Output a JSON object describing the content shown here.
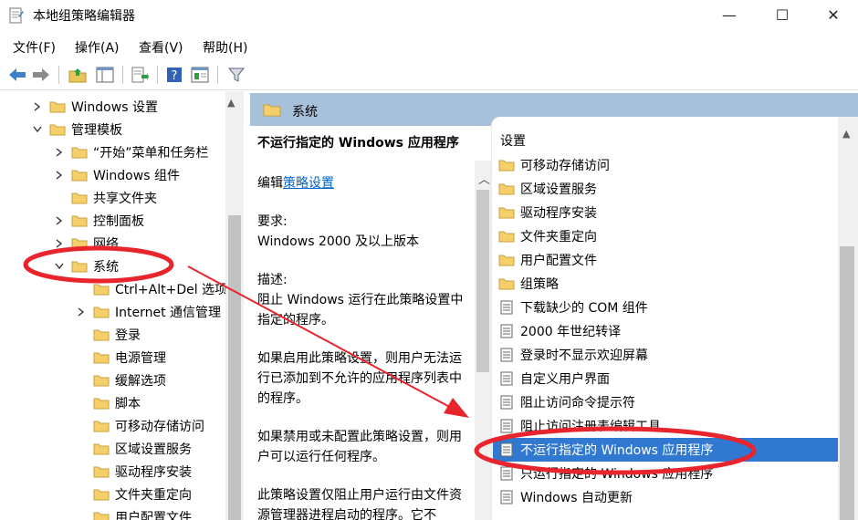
{
  "window": {
    "title": "本地组策略编辑器",
    "controls": {
      "minimize": "—",
      "maximize": "☐",
      "close": "✕"
    }
  },
  "menubar": {
    "items": [
      "文件(F)",
      "操作(A)",
      "查看(V)",
      "帮助(H)"
    ]
  },
  "toolbar": {
    "icons": [
      "back-arrow-icon",
      "forward-arrow-icon",
      "up-folder-icon",
      "show-hide-tree-icon",
      "export-list-icon",
      "help-icon",
      "properties-icon",
      "filter-icon"
    ]
  },
  "tree": {
    "items": [
      {
        "label": "Windows 设置",
        "chevron": "right",
        "level": 1
      },
      {
        "label": "管理模板",
        "chevron": "down",
        "level": 1
      },
      {
        "label": "“开始”菜单和任务栏",
        "chevron": "right",
        "level": 2
      },
      {
        "label": "Windows 组件",
        "chevron": "right",
        "level": 2
      },
      {
        "label": "共享文件夹",
        "chevron": "",
        "level": 2
      },
      {
        "label": "控制面板",
        "chevron": "right",
        "level": 2
      },
      {
        "label": "网络",
        "chevron": "right",
        "level": 2
      },
      {
        "label": "系统",
        "chevron": "down",
        "level": 2
      },
      {
        "label": "Ctrl+Alt+Del 选项",
        "chevron": "",
        "level": 3
      },
      {
        "label": "Internet 通信管理",
        "chevron": "right",
        "level": 3
      },
      {
        "label": "登录",
        "chevron": "",
        "level": 3
      },
      {
        "label": "电源管理",
        "chevron": "",
        "level": 3
      },
      {
        "label": "缓解选项",
        "chevron": "",
        "level": 3
      },
      {
        "label": "脚本",
        "chevron": "",
        "level": 3
      },
      {
        "label": "可移动存储访问",
        "chevron": "",
        "level": 3
      },
      {
        "label": "区域设置服务",
        "chevron": "",
        "level": 3
      },
      {
        "label": "驱动程序安装",
        "chevron": "",
        "level": 3
      },
      {
        "label": "文件夹重定向",
        "chevron": "",
        "level": 3
      },
      {
        "label": "用户配置文件",
        "chevron": "",
        "level": 3
      }
    ]
  },
  "right_header": {
    "title": "系统"
  },
  "description": {
    "policy_title": "不运行指定的 Windows 应用程序",
    "edit_prefix": "编辑",
    "edit_link": "策略设置",
    "requirements_label": "要求:",
    "requirements_value": "Windows 2000 及以上版本",
    "description_label": "描述:",
    "description_text": "阻止 Windows 运行在此策略设置中指定的程序。",
    "enabled_text": "如果启用此策略设置，则用户无法运行已添加到不允许的应用程序列表中的程序。",
    "disabled_text": "如果禁用或未配置此策略设置，则用户可以运行任何程序。",
    "note_text": "此策略设置仅阻止用户运行由文件资源管理器进程启动的程序。它不"
  },
  "settings_list": {
    "header": "设置",
    "items": [
      {
        "label": "可移动存储访问",
        "icon": "folder-icon"
      },
      {
        "label": "区域设置服务",
        "icon": "folder-icon"
      },
      {
        "label": "驱动程序安装",
        "icon": "folder-icon"
      },
      {
        "label": "文件夹重定向",
        "icon": "folder-icon"
      },
      {
        "label": "用户配置文件",
        "icon": "folder-icon"
      },
      {
        "label": "组策略",
        "icon": "folder-icon"
      },
      {
        "label": "下载缺少的 COM 组件",
        "icon": "policy-setting-icon"
      },
      {
        "label": "2000 年世纪转译",
        "icon": "policy-setting-icon"
      },
      {
        "label": "登录时不显示欢迎屏幕",
        "icon": "policy-setting-icon"
      },
      {
        "label": "自定义用户界面",
        "icon": "policy-setting-icon"
      },
      {
        "label": "阻止访问命令提示符",
        "icon": "policy-setting-icon"
      },
      {
        "label": "阻止访问注册表编辑工具",
        "icon": "policy-setting-icon"
      },
      {
        "label": "不运行指定的 Windows 应用程序",
        "icon": "policy-setting-icon",
        "selected": true
      },
      {
        "label": "只运行指定的 Windows 应用程序",
        "icon": "policy-setting-icon"
      },
      {
        "label": "Windows 自动更新",
        "icon": "policy-setting-icon"
      }
    ]
  },
  "colors": {
    "selection": "#3078d0",
    "header_band": "#a8c1da",
    "annotation_red": "#e8242c",
    "folder_yellow": "#f4cf6a"
  }
}
